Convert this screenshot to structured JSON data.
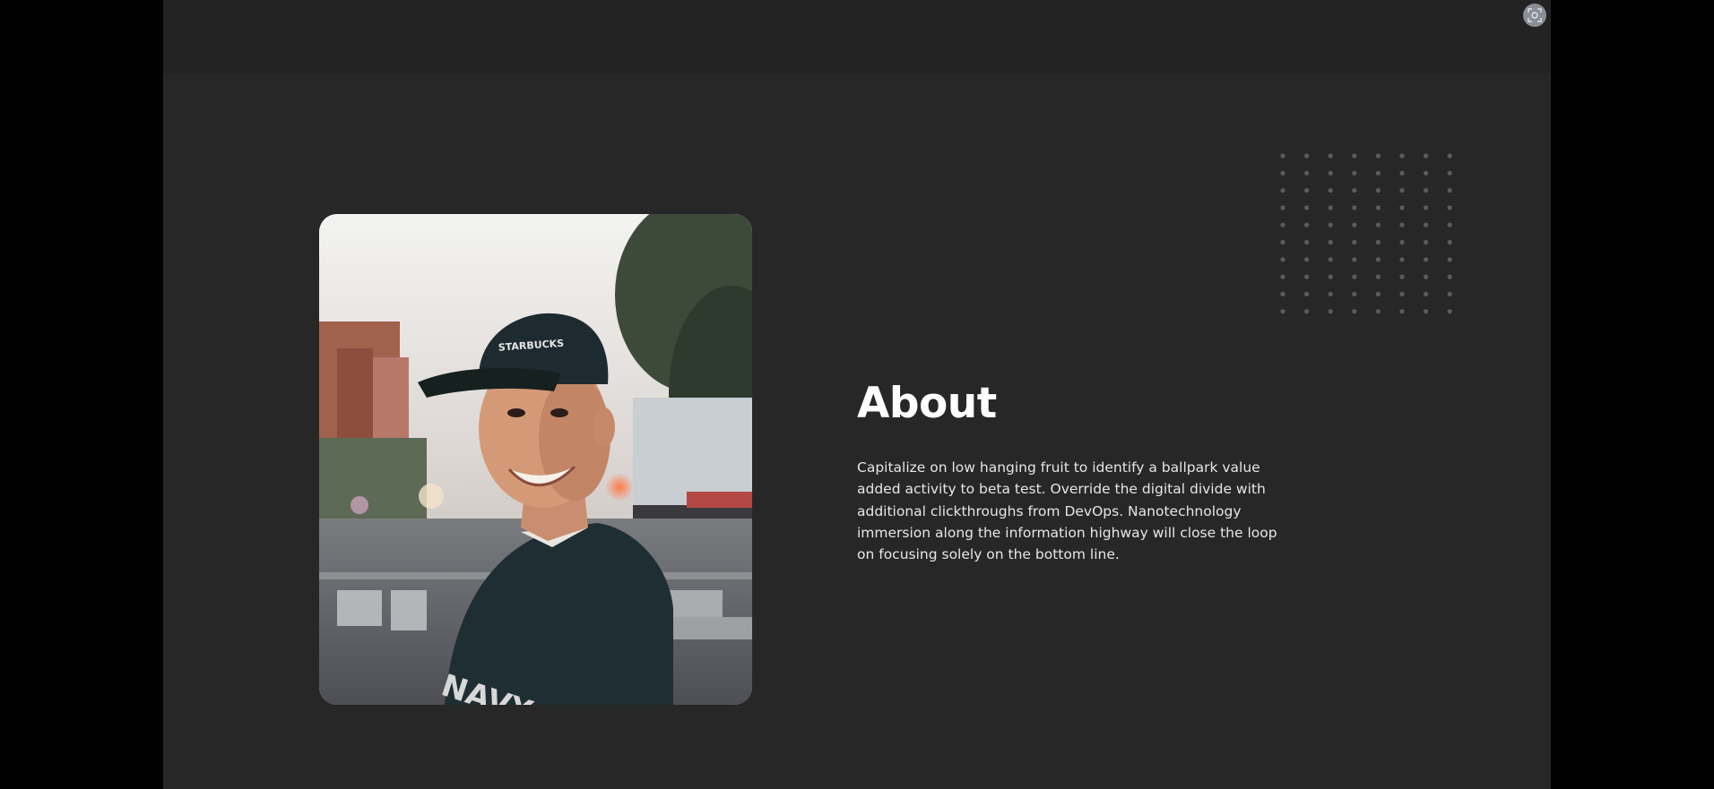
{
  "about": {
    "heading": "About",
    "body": "Capitalize on low hanging fruit to identify a ballpark value added activity to beta test. Override the digital divide with additional clickthroughs from DevOps. Nanotechnology immersion along the information highway will close the loop on focusing solely on the bottom line."
  },
  "photo": {
    "subject": "smiling man in baseball cap on city street",
    "cap_text": "STARBUCKS",
    "shirt_text": "NAVY"
  },
  "icons": {
    "corner_button": "screenshot-capture-icon",
    "decoration": "dot-grid"
  },
  "colors": {
    "page_background": "#272727",
    "top_bar": "#232323",
    "outer_background": "#000000",
    "heading": "#ffffff",
    "body_text": "#e6e6e6",
    "dots": "#5c5c5c"
  }
}
